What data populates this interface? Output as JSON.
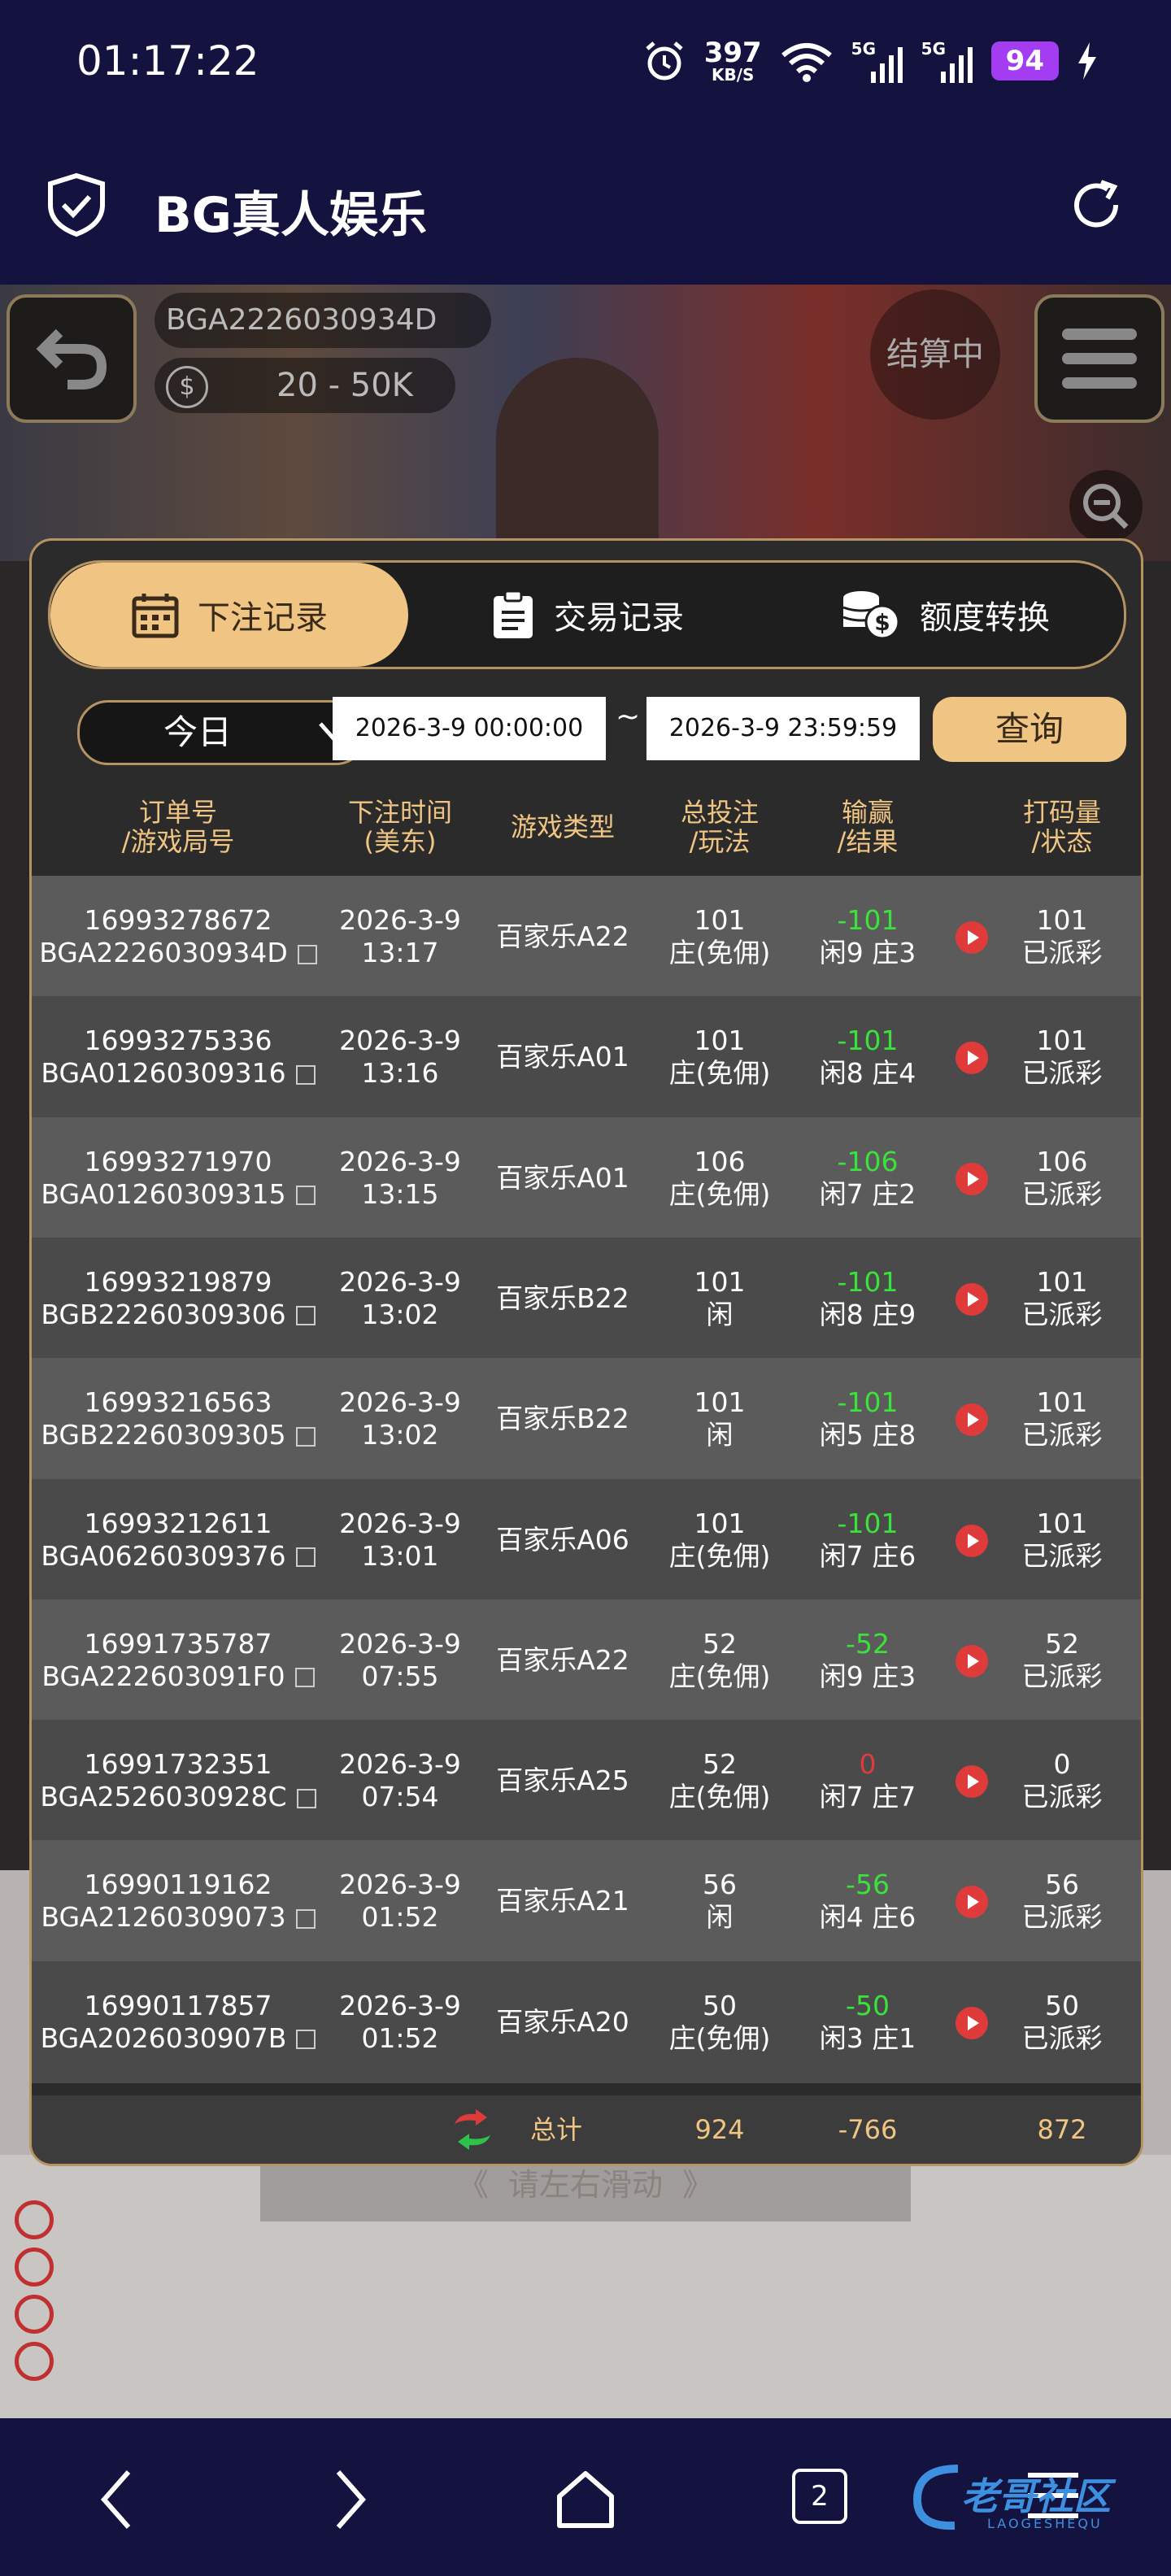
{
  "status_bar": {
    "time": "01:17:22",
    "speed_value": "397",
    "speed_unit": "KB/S",
    "net1": "5G",
    "net2": "5G",
    "battery": "94"
  },
  "app_bar": {
    "title": "BG真人娱乐"
  },
  "game": {
    "room_code": "BGA2226030934D",
    "limit": "20 - 50K",
    "settling": "结算中",
    "swipe_hint": "请左右滑动"
  },
  "modal": {
    "tabs": [
      {
        "label": "下注记录",
        "icon": "calendar-icon",
        "active": true
      },
      {
        "label": "交易记录",
        "icon": "clipboard-icon",
        "active": false
      },
      {
        "label": "额度转换",
        "icon": "coins-icon",
        "active": false
      }
    ],
    "filter": {
      "day": "今日",
      "start": "2026-3-9 00:00:00",
      "separator": "~",
      "end": "2026-3-9 23:59:59",
      "query_label": "查询"
    },
    "columns": [
      {
        "l1": "订单号",
        "l2": "/游戏局号"
      },
      {
        "l1": "下注时间",
        "l2": "(美东)"
      },
      {
        "l1": "游戏类型",
        "l2": ""
      },
      {
        "l1": "总投注",
        "l2": "/玩法"
      },
      {
        "l1": "输赢",
        "l2": "/结果"
      },
      {
        "l1": "打码量",
        "l2": "/状态"
      }
    ],
    "rows": [
      {
        "order": "16993278672",
        "round": "BGA2226030934D",
        "date": "2026-3-9",
        "time": "13:17",
        "game": "百家乐A22",
        "bet": "101",
        "play": "庄(免佣)",
        "win": "-101",
        "result": "闲9 庄3",
        "turnover": "101",
        "status": "已派彩"
      },
      {
        "order": "16993275336",
        "round": "BGA01260309316",
        "date": "2026-3-9",
        "time": "13:16",
        "game": "百家乐A01",
        "bet": "101",
        "play": "庄(免佣)",
        "win": "-101",
        "result": "闲8 庄4",
        "turnover": "101",
        "status": "已派彩"
      },
      {
        "order": "16993271970",
        "round": "BGA01260309315",
        "date": "2026-3-9",
        "time": "13:15",
        "game": "百家乐A01",
        "bet": "106",
        "play": "庄(免佣)",
        "win": "-106",
        "result": "闲7 庄2",
        "turnover": "106",
        "status": "已派彩"
      },
      {
        "order": "16993219879",
        "round": "BGB22260309306",
        "date": "2026-3-9",
        "time": "13:02",
        "game": "百家乐B22",
        "bet": "101",
        "play": "闲",
        "win": "-101",
        "result": "闲8 庄9",
        "turnover": "101",
        "status": "已派彩"
      },
      {
        "order": "16993216563",
        "round": "BGB22260309305",
        "date": "2026-3-9",
        "time": "13:02",
        "game": "百家乐B22",
        "bet": "101",
        "play": "闲",
        "win": "-101",
        "result": "闲5 庄8",
        "turnover": "101",
        "status": "已派彩"
      },
      {
        "order": "16993212611",
        "round": "BGA06260309376",
        "date": "2026-3-9",
        "time": "13:01",
        "game": "百家乐A06",
        "bet": "101",
        "play": "庄(免佣)",
        "win": "-101",
        "result": "闲7 庄6",
        "turnover": "101",
        "status": "已派彩"
      },
      {
        "order": "16991735787",
        "round": "BGA222603091F0",
        "date": "2026-3-9",
        "time": "07:55",
        "game": "百家乐A22",
        "bet": "52",
        "play": "庄(免佣)",
        "win": "-52",
        "result": "闲9 庄3",
        "turnover": "52",
        "status": "已派彩"
      },
      {
        "order": "16991732351",
        "round": "BGA2526030928C",
        "date": "2026-3-9",
        "time": "07:54",
        "game": "百家乐A25",
        "bet": "52",
        "play": "庄(免佣)",
        "win": "0",
        "result": "闲7 庄7",
        "turnover": "0",
        "status": "已派彩"
      },
      {
        "order": "16990119162",
        "round": "BGA21260309073",
        "date": "2026-3-9",
        "time": "01:52",
        "game": "百家乐A21",
        "bet": "56",
        "play": "闲",
        "win": "-56",
        "result": "闲4 庄6",
        "turnover": "56",
        "status": "已派彩"
      },
      {
        "order": "16990117857",
        "round": "BGA2026030907B",
        "date": "2026-3-9",
        "time": "01:52",
        "game": "百家乐A20",
        "bet": "50",
        "play": "庄(免佣)",
        "win": "-50",
        "result": "闲3 庄1",
        "turnover": "50",
        "status": "已派彩"
      }
    ],
    "totals": {
      "label": "总计",
      "bet": "924",
      "win": "-766",
      "turnover": "872"
    }
  },
  "nav_bar": {
    "tabs_count": "2"
  },
  "watermark": {
    "text": "老哥社区",
    "sub": "LAOGESHEQU"
  },
  "colors": {
    "accent_gold": "#f0c583",
    "border_gold": "#b69363",
    "loss_green": "#3be23b",
    "zero_red": "#e03b3b",
    "bar_navy": "#14123f"
  }
}
